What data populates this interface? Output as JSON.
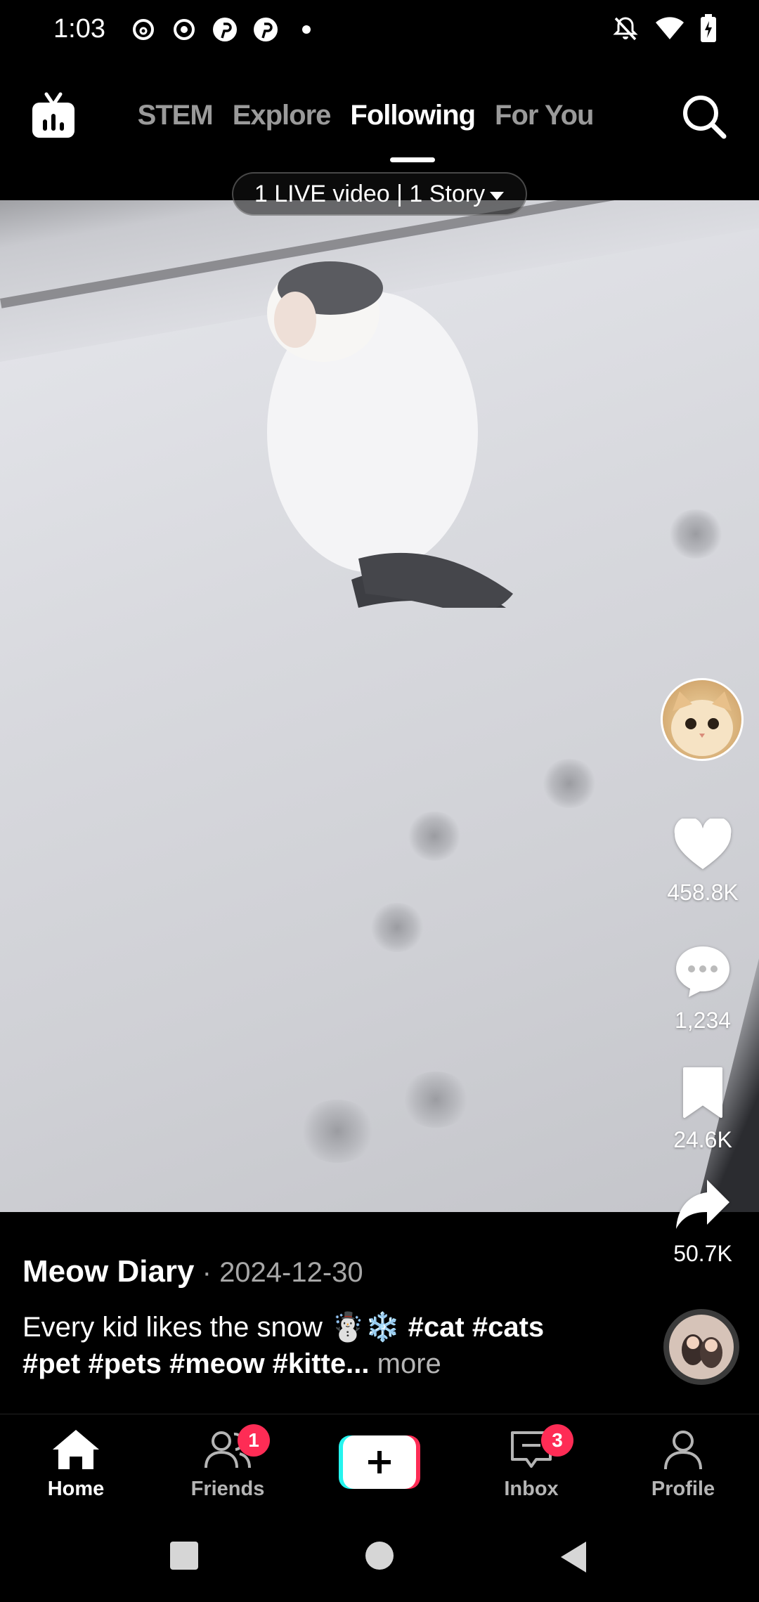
{
  "status_bar": {
    "time": "1:03"
  },
  "top_nav": {
    "tabs": [
      {
        "label": "STEM"
      },
      {
        "label": "Explore"
      },
      {
        "label": "Following"
      },
      {
        "label": "For You"
      }
    ],
    "active_tab": "Following"
  },
  "live_pill": {
    "text": "1 LIVE video | 1 Story"
  },
  "actions": {
    "likes": "458.8K",
    "comments": "1,234",
    "saves": "24.6K",
    "shares": "50.7K"
  },
  "post": {
    "creator": "Meow Diary",
    "date": " · 2024-12-30",
    "caption_text": "Every kid likes the snow ☃️❄️ ",
    "hashtags": "#cat #cats #pet #pets #meow #kitte...",
    "more": "more"
  },
  "bottom_nav": {
    "home": "Home",
    "friends": "Friends",
    "friends_badge": "1",
    "inbox": "Inbox",
    "inbox_badge": "3",
    "profile": "Profile"
  },
  "colors": {
    "accent_red": "#fe2c55",
    "accent_cyan": "#25f4ee"
  }
}
